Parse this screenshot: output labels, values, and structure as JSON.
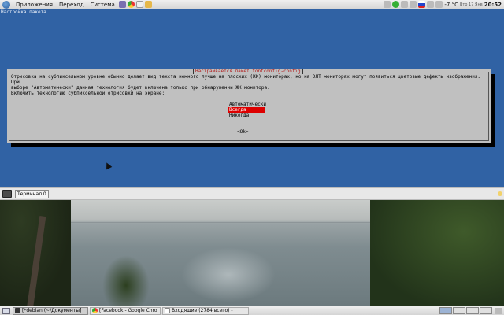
{
  "top_panel": {
    "menus": [
      "Приложения",
      "Переход",
      "Система"
    ],
    "launchers": [
      "terminal-launcher-icon",
      "chrome-launcher-icon",
      "text-editor-launcher-icon",
      "file-manager-launcher-icon"
    ],
    "date": "Втр 17 Янв",
    "temperature": "-7 °C",
    "time": "20:52"
  },
  "terminal": {
    "header_text": "Настройка пакета",
    "dialog": {
      "title": "Настраивается пакет fontconfig-config",
      "description": "Отрисовка на субпиксельном уровне обычно делает вид текста немного лучше на плоских (ЖК) мониторах, но на ЭЛТ мониторах могут появиться цветовые дефекты изображения. При\nвыборе \"Автоматически\" данная технология будет включена только при обнаружении ЖК монитора.",
      "question": "Включить технологию субпиксельной отрисовки на экране:",
      "options": [
        "Автоматически",
        "Всегда",
        "Никогда"
      ],
      "selected_option": "Всегда",
      "ok_label": "<Ok>"
    }
  },
  "tabbar": {
    "tab_label": "Терминал 0"
  },
  "taskbar": {
    "tasks": [
      {
        "label": "[*debian (~/Документы]",
        "icon": "terminal-icon"
      },
      {
        "label": "[Facebook - Google Chro",
        "icon": "chrome-icon"
      },
      {
        "label": "Входящие (2784 всего) -",
        "icon": "mail-icon"
      }
    ],
    "workspaces": 4
  },
  "colors": {
    "terminal_bg": "#3062a4",
    "dialog_bg": "#c0c0c0",
    "selection": "#dd0000",
    "title_text": "#b01818"
  }
}
